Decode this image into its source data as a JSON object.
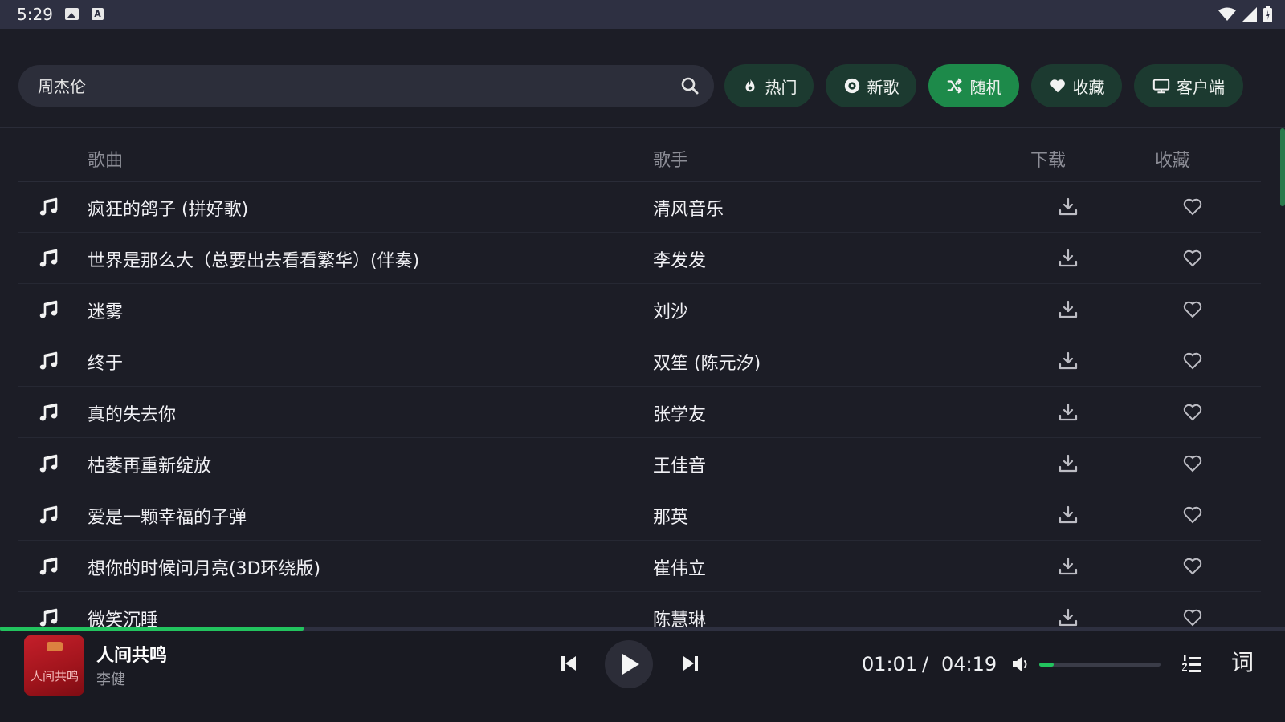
{
  "status_bar": {
    "time": "5:29"
  },
  "search": {
    "value": "周杰伦"
  },
  "chips": [
    {
      "label": "热门",
      "icon": "fire-icon"
    },
    {
      "label": "新歌",
      "icon": "disc-icon"
    },
    {
      "label": "随机",
      "icon": "shuffle-icon",
      "active": true
    },
    {
      "label": "收藏",
      "icon": "heart-icon"
    },
    {
      "label": "客户端",
      "icon": "monitor-icon"
    }
  ],
  "table": {
    "headers": {
      "song": "歌曲",
      "artist": "歌手",
      "download": "下载",
      "favorite": "收藏"
    },
    "rows": [
      {
        "title": "疯狂的鸽子 (拼好歌)",
        "artist": "清风音乐"
      },
      {
        "title": "世界是那么大（总要出去看看繁华）(伴奏)",
        "artist": "李发发"
      },
      {
        "title": "迷雾",
        "artist": "刘沙"
      },
      {
        "title": "终于",
        "artist": "双笙 (陈元汐)"
      },
      {
        "title": "真的失去你",
        "artist": "张学友"
      },
      {
        "title": "枯萎再重新绽放",
        "artist": "王佳音"
      },
      {
        "title": "爱是一颗幸福的子弹",
        "artist": "那英"
      },
      {
        "title": "想你的时候问月亮(3D环绕版)",
        "artist": "崔伟立"
      },
      {
        "title": "微笑沉睡",
        "artist": "陈慧琳"
      }
    ]
  },
  "player": {
    "title": "人间共鸣",
    "artist": "李健",
    "cover_text": "人间共鸣",
    "current_time": "01:01",
    "separator": "/",
    "total_time": "04:19",
    "progress": 0.236,
    "volume": 0.12,
    "lyrics_label": "词"
  },
  "colors": {
    "accent": "#22c35e",
    "chip_active": "#1d8a4a",
    "chip": "#1c3a30",
    "background": "#1c1d26"
  }
}
